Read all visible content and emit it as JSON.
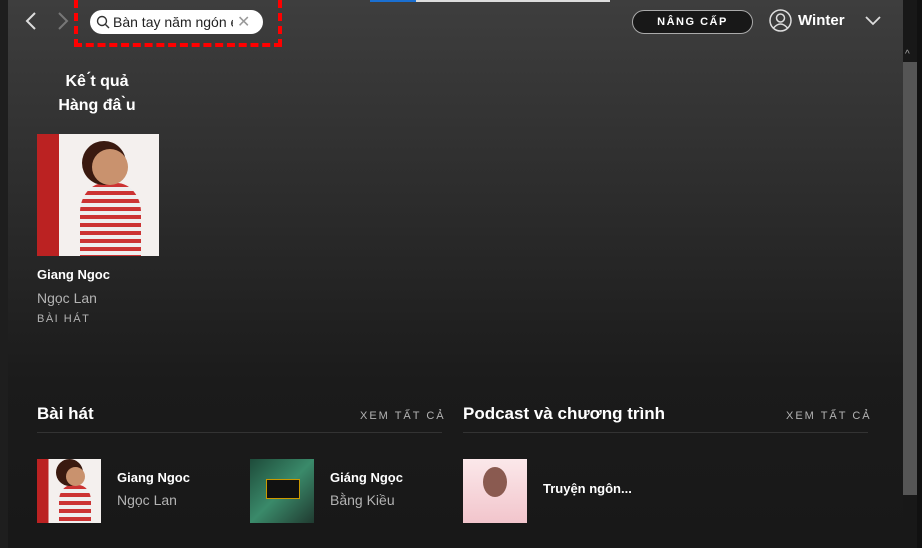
{
  "header": {
    "search_value": "Bàn tay năm ngón e",
    "upgrade_label": "NÂNG CẤP",
    "username": "Winter"
  },
  "top_result": {
    "heading_line1": "Kê ́t quả",
    "heading_line2": "Hàng đâ ̀u",
    "title": "Giang Ngoc",
    "artist": "Ngọc Lan",
    "type": "BÀI HÁT"
  },
  "songs": {
    "title": "Bài hát",
    "see_all": "XEM TẤT CẢ",
    "items": [
      {
        "title": "Giang Ngoc",
        "artist": "Ngọc Lan"
      },
      {
        "title": "Giáng Ngọc",
        "artist": "Bằng Kiều"
      }
    ]
  },
  "podcasts": {
    "title": "Podcast và chương trình",
    "see_all": "XEM TẤT CẢ",
    "items": [
      {
        "title": "Truyện ngôn..."
      }
    ]
  },
  "colors": {
    "accent": "#1a6fd1",
    "highlight": "#ff0000"
  }
}
